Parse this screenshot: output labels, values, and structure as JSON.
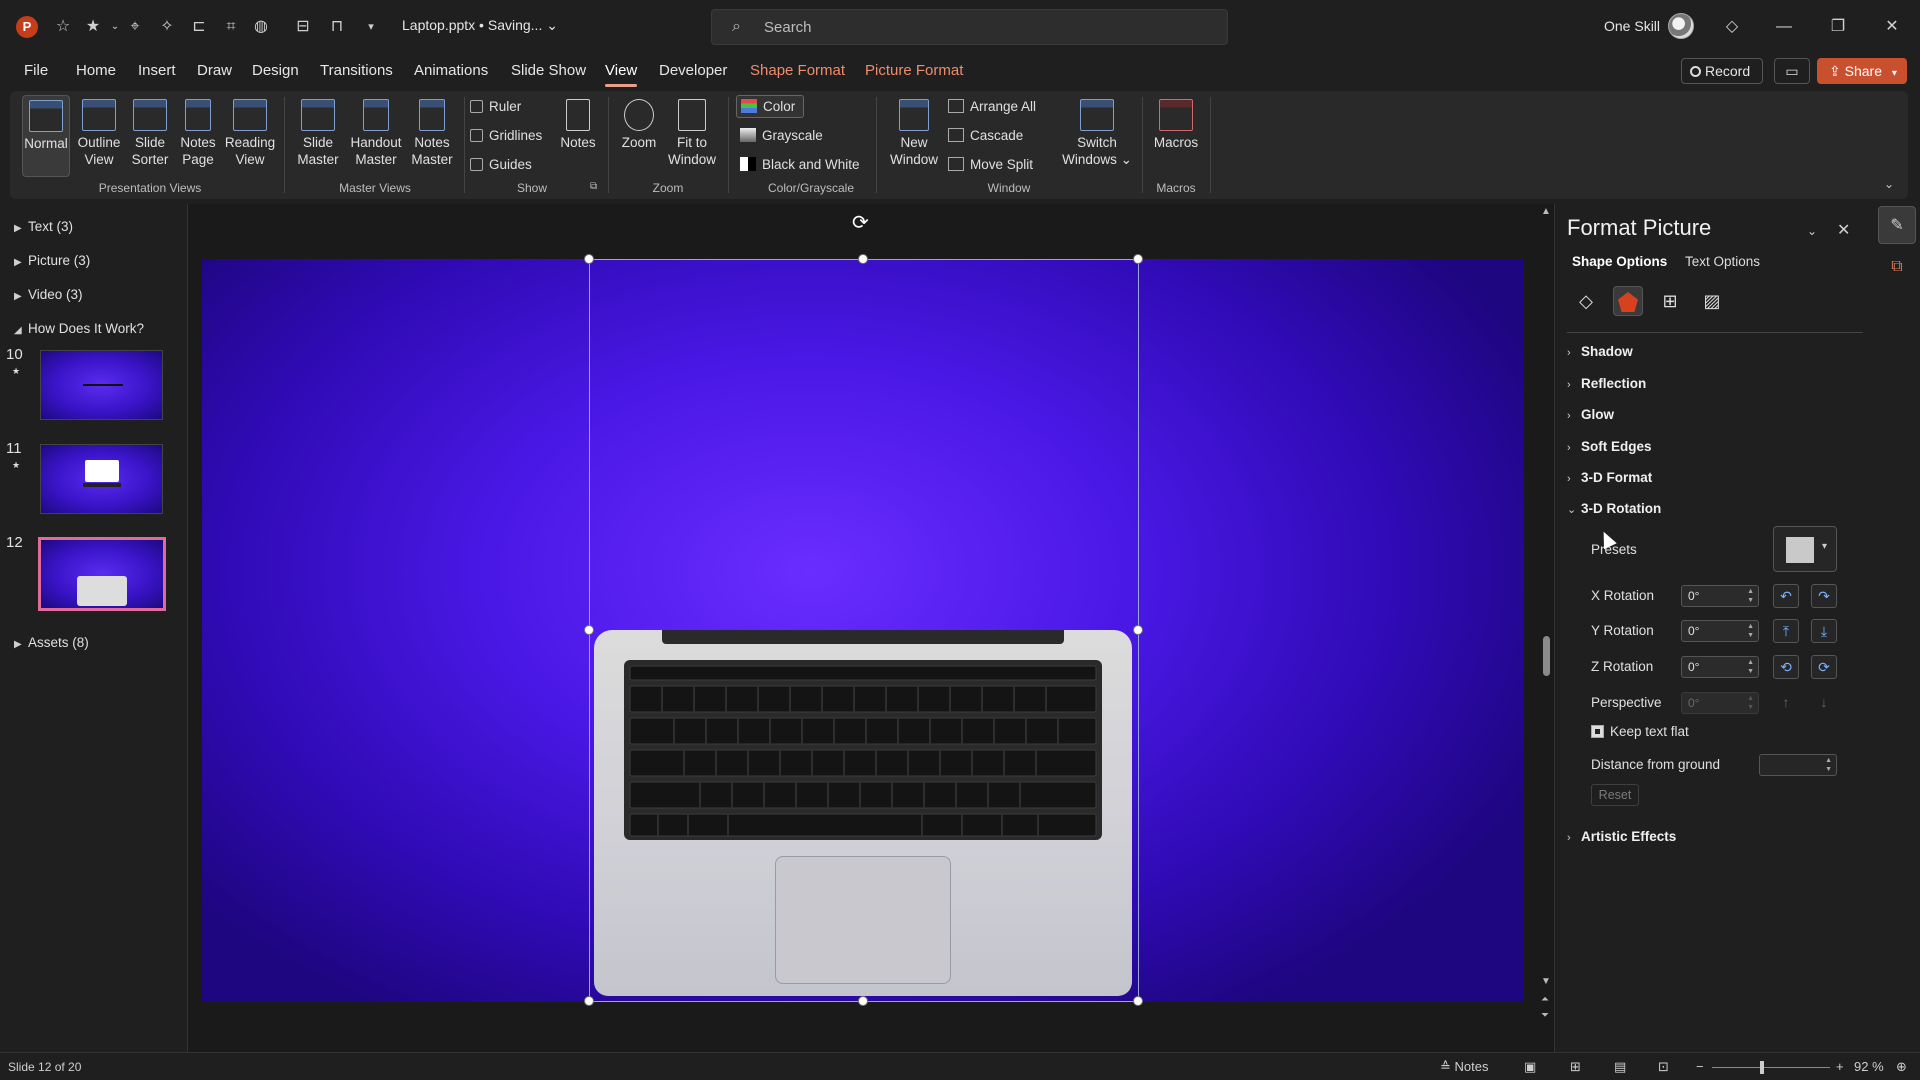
{
  "title_bar": {
    "doc_title": "Laptop.pptx • Saving... ⌄",
    "search_placeholder": "Search",
    "user_name": "One Skill"
  },
  "tabs": [
    "File",
    "Home",
    "Insert",
    "Draw",
    "Design",
    "Transitions",
    "Animations",
    "Slide Show",
    "View",
    "Developer",
    "Shape Format",
    "Picture Format"
  ],
  "active_tab": "View",
  "header_buttons": {
    "record": "Record",
    "share": "Share"
  },
  "ribbon": {
    "presentation_views": {
      "label": "Presentation Views",
      "normal": "Normal",
      "outline_view": [
        "Outline",
        "View"
      ],
      "slide_sorter": [
        "Slide",
        "Sorter"
      ],
      "notes_page": [
        "Notes",
        "Page"
      ],
      "reading_view": [
        "Reading",
        "View"
      ]
    },
    "master_views": {
      "label": "Master Views",
      "slide_master": [
        "Slide",
        "Master"
      ],
      "handout_master": [
        "Handout",
        "Master"
      ],
      "notes_master": [
        "Notes",
        "Master"
      ]
    },
    "show": {
      "label": "Show",
      "ruler": "Ruler",
      "gridlines": "Gridlines",
      "guides": "Guides",
      "notes": "Notes"
    },
    "zoom": {
      "label": "Zoom",
      "zoom": "Zoom",
      "fit_to_window": [
        "Fit to",
        "Window"
      ]
    },
    "color_grayscale": {
      "label": "Color/Grayscale",
      "color": "Color",
      "grayscale": "Grayscale",
      "black_and_white": "Black and White"
    },
    "window": {
      "label": "Window",
      "new_window": [
        "New",
        "Window"
      ],
      "arrange_all": "Arrange All",
      "cascade": "Cascade",
      "move_split": "Move Split",
      "switch_windows": [
        "Switch",
        "Windows ⌄"
      ]
    },
    "macros": {
      "label": "Macros",
      "macros": "Macros"
    }
  },
  "outline": {
    "sections": [
      "Text (3)",
      "Picture (3)",
      "Video (3)",
      "How Does It Work?",
      "Assets (8)"
    ],
    "slides": [
      {
        "num": "10",
        "star": "★"
      },
      {
        "num": "11",
        "star": "★"
      },
      {
        "num": "12",
        "star": ""
      }
    ]
  },
  "format_pane": {
    "title": "Format Picture",
    "subtabs": [
      "Shape Options",
      "Text Options"
    ],
    "sections": [
      "Shadow",
      "Reflection",
      "Glow",
      "Soft Edges",
      "3-D Format",
      "3-D Rotation"
    ],
    "rotation": {
      "presets": "Presets",
      "x_rotation": "X Rotation",
      "x_value": "0°",
      "y_rotation": "Y Rotation",
      "y_value": "0°",
      "z_rotation": "Z Rotation",
      "z_value": "0°",
      "perspective": "Perspective",
      "perspective_value": "0°",
      "keep_text_flat": "Keep text flat",
      "distance_from_ground": "Distance from ground",
      "reset": "Reset"
    },
    "artistic_effects": "Artistic Effects"
  },
  "status_bar": {
    "slide_info": "Slide 12 of 20",
    "notes": "Notes",
    "zoom_level": "92 %"
  },
  "colors": {
    "accent": "#ef8c6f",
    "share": "#c9502e",
    "slide_bg": "#4a18e6",
    "selected_thumb_border": "#e06a9a"
  }
}
